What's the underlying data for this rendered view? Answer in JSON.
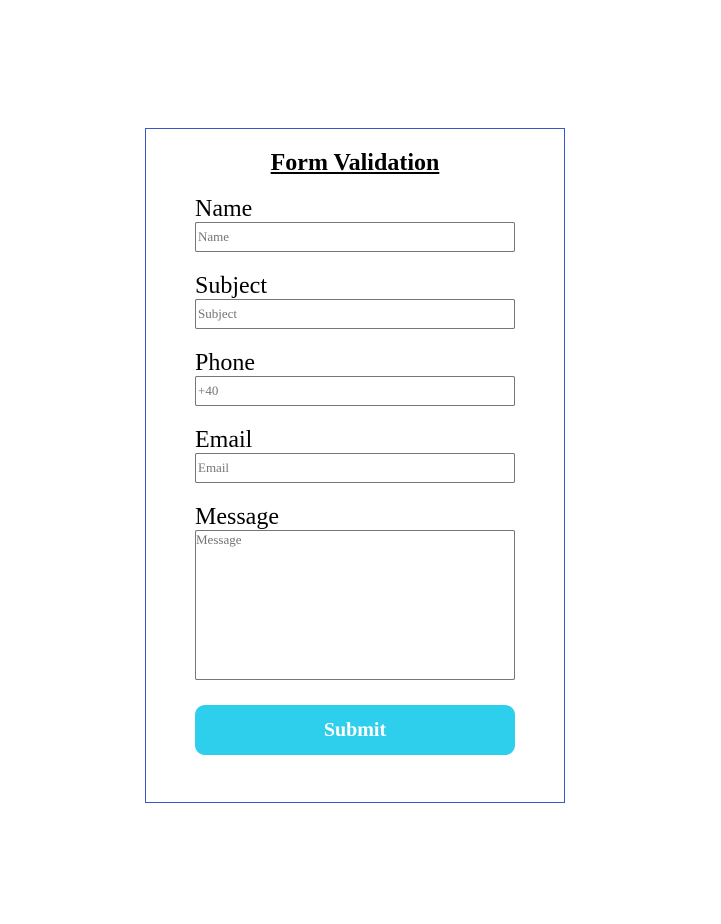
{
  "form": {
    "title": "Form Validation",
    "fields": {
      "name": {
        "label": "Name",
        "placeholder": "Name",
        "value": ""
      },
      "subject": {
        "label": "Subject",
        "placeholder": "Subject",
        "value": ""
      },
      "phone": {
        "label": "Phone",
        "placeholder": "+40",
        "value": ""
      },
      "email": {
        "label": "Email",
        "placeholder": "Email",
        "value": ""
      },
      "message": {
        "label": "Message",
        "placeholder": "Message",
        "value": ""
      }
    },
    "submit_label": "Submit"
  },
  "colors": {
    "card_border": "#3a56c8",
    "submit_background": "#2dcfed",
    "submit_text": "#ffffff"
  }
}
